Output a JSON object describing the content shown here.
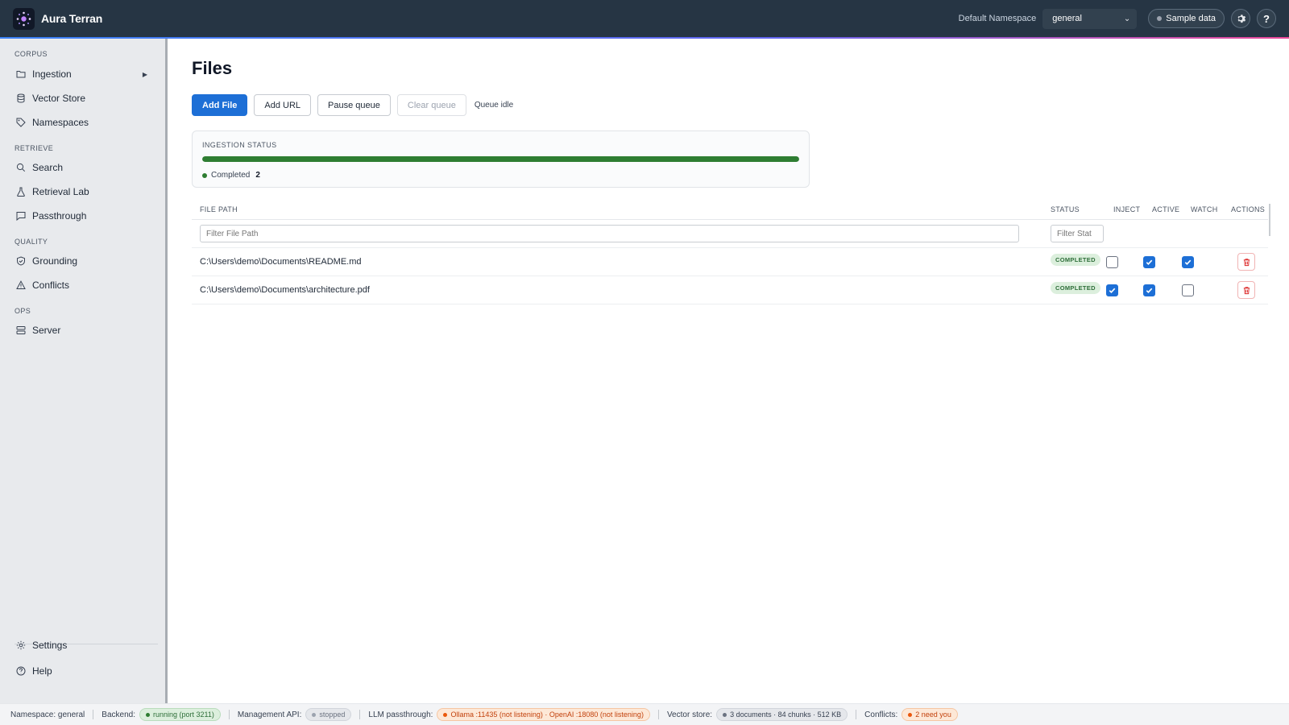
{
  "app": {
    "title": "Aura Terran"
  },
  "topbar": {
    "namespace_label": "Default Namespace",
    "namespace_value": "general",
    "sample_data_label": "Sample data",
    "help_label": "?"
  },
  "sidebar": {
    "sections": [
      {
        "title": "CORPUS",
        "items": [
          {
            "label": "Ingestion",
            "icon": "folder-icon",
            "expandable": true
          },
          {
            "label": "Vector Store",
            "icon": "database-icon"
          },
          {
            "label": "Namespaces",
            "icon": "tag-icon"
          }
        ]
      },
      {
        "title": "RETRIEVE",
        "items": [
          {
            "label": "Search",
            "icon": "search-icon"
          },
          {
            "label": "Retrieval Lab",
            "icon": "flask-icon"
          },
          {
            "label": "Passthrough",
            "icon": "message-icon"
          }
        ]
      },
      {
        "title": "QUALITY",
        "items": [
          {
            "label": "Grounding",
            "icon": "shield-check-icon"
          },
          {
            "label": "Conflicts",
            "icon": "warning-icon"
          }
        ]
      },
      {
        "title": "OPS",
        "items": [
          {
            "label": "Server",
            "icon": "server-icon"
          }
        ]
      }
    ],
    "bottom": [
      {
        "label": "Settings",
        "icon": "gear-icon"
      },
      {
        "label": "Help",
        "icon": "help-icon"
      }
    ]
  },
  "page": {
    "title": "Files",
    "buttons": {
      "add_file": "Add File",
      "add_url": "Add URL",
      "pause_queue": "Pause queue",
      "clear_queue": "Clear queue"
    },
    "queue_status": "Queue idle",
    "ingestion": {
      "label": "INGESTION STATUS",
      "progress": 1.0,
      "legend_label": "Completed",
      "legend_count": "2",
      "color": "#2e7d32"
    }
  },
  "table": {
    "headers": {
      "file_path": "FILE PATH",
      "status": "STATUS",
      "inject": "INJECT",
      "active": "ACTIVE",
      "watch": "WATCH",
      "actions": "ACTIONS"
    },
    "filters": {
      "file_path_placeholder": "Filter File Path",
      "status_placeholder": "Filter Stat"
    },
    "rows": [
      {
        "path": "C:\\Users\\demo\\Documents\\README.md",
        "status": "COMPLETED",
        "inject": false,
        "active": true,
        "watch": true
      },
      {
        "path": "C:\\Users\\demo\\Documents\\architecture.pdf",
        "status": "COMPLETED",
        "inject": true,
        "active": true,
        "watch": false
      }
    ]
  },
  "footer": {
    "namespace": "Namespace: general",
    "backend_label": "Backend:",
    "backend_value": "running (port 3211)",
    "management_label": "Management API:",
    "management_value": "stopped",
    "llm_label": "LLM passthrough:",
    "llm_value": "Ollama :11435 (not listening) · OpenAI :18080 (not listening)",
    "vector_label": "Vector store:",
    "vector_value": "3 documents · 84 chunks · 512 KB",
    "conflicts_label": "Conflicts:",
    "conflicts_value": "2 need you"
  },
  "colors": {
    "topbar": "#263544",
    "primary": "#1d6fd6",
    "success": "#2e7d32",
    "danger": "#dc2626"
  }
}
